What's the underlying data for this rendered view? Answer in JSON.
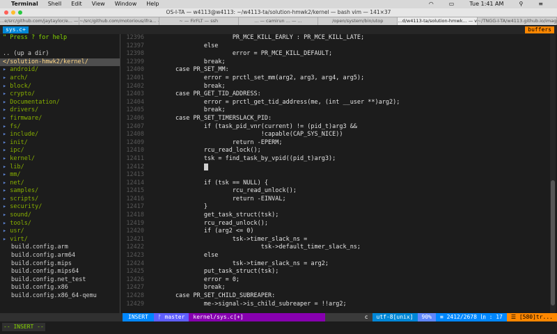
{
  "menubar": {
    "app": "Terminal",
    "items": [
      "Shell",
      "Edit",
      "View",
      "Window",
      "Help"
    ],
    "clock": "Tue 1:41 AM"
  },
  "window": {
    "title": "OS-I-TA — w4113@w4113: ~/w4113-ta/solution-hmwk2/kernel — bash vim — 141×37"
  },
  "tabs": [
    "...e/src/github.com/jaytaylor/e... — bash",
    "~/src/github.com/motorious/ifra... — bash",
    "~ — FirFLT — ssh",
    "... — camirun ... — ...",
    "/open/system/bin/utop",
    "...d/w4113-ta/solution-hmwk... — vim",
    "~/TNGG-I-TA/w4113.github.io/images — bash"
  ],
  "vim": {
    "left_tab": "sys.c+",
    "right_tab": "buffers"
  },
  "tree": {
    "help": "\" Press ? for help",
    "updir": ".. (up a dir)",
    "current": "</solution-hmwk2/kernel/",
    "dirs": [
      "android/",
      "arch/",
      "block/",
      "crypto/",
      "Documentation/",
      "drivers/",
      "firmware/",
      "fs/",
      "include/",
      "init/",
      "ipc/",
      "kernel/",
      "lib/",
      "mm/",
      "net/",
      "samples/",
      "scripts/",
      "security/",
      "sound/",
      "tools/",
      "usr/",
      "virt/"
    ],
    "files": [
      "build.config.arm",
      "build.config.arm64",
      "build.config.mips",
      "build.config.mips64",
      "build.config.net_test",
      "build.config.x86",
      "build.config.x86_64-qemu"
    ]
  },
  "code": {
    "lines": [
      {
        "n": "12396",
        "t": "                        PR_MCE_KILL_EARLY : PR_MCE_KILL_LATE;"
      },
      {
        "n": "12397",
        "t": "                else"
      },
      {
        "n": "12398",
        "t": "                        error = PR_MCE_KILL_DEFAULT;"
      },
      {
        "n": "12399",
        "t": "                break;"
      },
      {
        "n": "12400",
        "t": "        case PR_SET_MM:"
      },
      {
        "n": "12401",
        "t": "                error = prctl_set_mm(arg2, arg3, arg4, arg5);"
      },
      {
        "n": "12402",
        "t": "                break;"
      },
      {
        "n": "12403",
        "t": "        case PR_GET_TID_ADDRESS:"
      },
      {
        "n": "12404",
        "t": "                error = prctl_get_tid_address(me, (int __user **)arg2);"
      },
      {
        "n": "12405",
        "t": "                break;"
      },
      {
        "n": "12406",
        "t": "        case PR_SET_TIMERSLACK_PID:"
      },
      {
        "n": "12407",
        "t": "                if (task_pid_vnr(current) != (pid_t)arg3 &&"
      },
      {
        "n": "12408",
        "t": "                                !capable(CAP_SYS_NICE))"
      },
      {
        "n": "12409",
        "t": "                        return -EPERM;"
      },
      {
        "n": "12410",
        "t": "                rcu_read_lock();"
      },
      {
        "n": "12411",
        "t": "                tsk = find_task_by_vpid((pid_t)arg3);"
      },
      {
        "n": "12412",
        "t": "                "
      },
      {
        "n": "12413",
        "t": ""
      },
      {
        "n": "12414",
        "t": "                if (tsk == NULL) {"
      },
      {
        "n": "12415",
        "t": "                        rcu_read_unlock();"
      },
      {
        "n": "12416",
        "t": "                        return -EINVAL;"
      },
      {
        "n": "12417",
        "t": "                }"
      },
      {
        "n": "12418",
        "t": "                get_task_struct(tsk);"
      },
      {
        "n": "12419",
        "t": "                rcu_read_unlock();"
      },
      {
        "n": "12420",
        "t": "                if (arg2 <= 0)"
      },
      {
        "n": "12421",
        "t": "                        tsk->timer_slack_ns ="
      },
      {
        "n": "12422",
        "t": "                                tsk->default_timer_slack_ns;"
      },
      {
        "n": "12423",
        "t": "                else"
      },
      {
        "n": "12424",
        "t": "                        tsk->timer_slack_ns = arg2;"
      },
      {
        "n": "12425",
        "t": "                put_task_struct(tsk);"
      },
      {
        "n": "12426",
        "t": "                error = 0;"
      },
      {
        "n": "12427",
        "t": "                break;"
      },
      {
        "n": "12428",
        "t": "        case PR_SET_CHILD_SUBREAPER:"
      },
      {
        "n": "12429",
        "t": "                me->signal->is_child_subreaper = !!arg2;"
      }
    ]
  },
  "statusline": {
    "mode": "INSERT",
    "branch": "ᚠ master",
    "file": "kernel/sys.c[+]",
    "filetype": "c",
    "encoding": "utf-8[unix]",
    "percent": "90%",
    "position": "≡ 2412/2678 ㏑ : 17",
    "warning": "☰ [580]tr..."
  },
  "cmdline": {
    "mode": "-- INSERT --"
  }
}
